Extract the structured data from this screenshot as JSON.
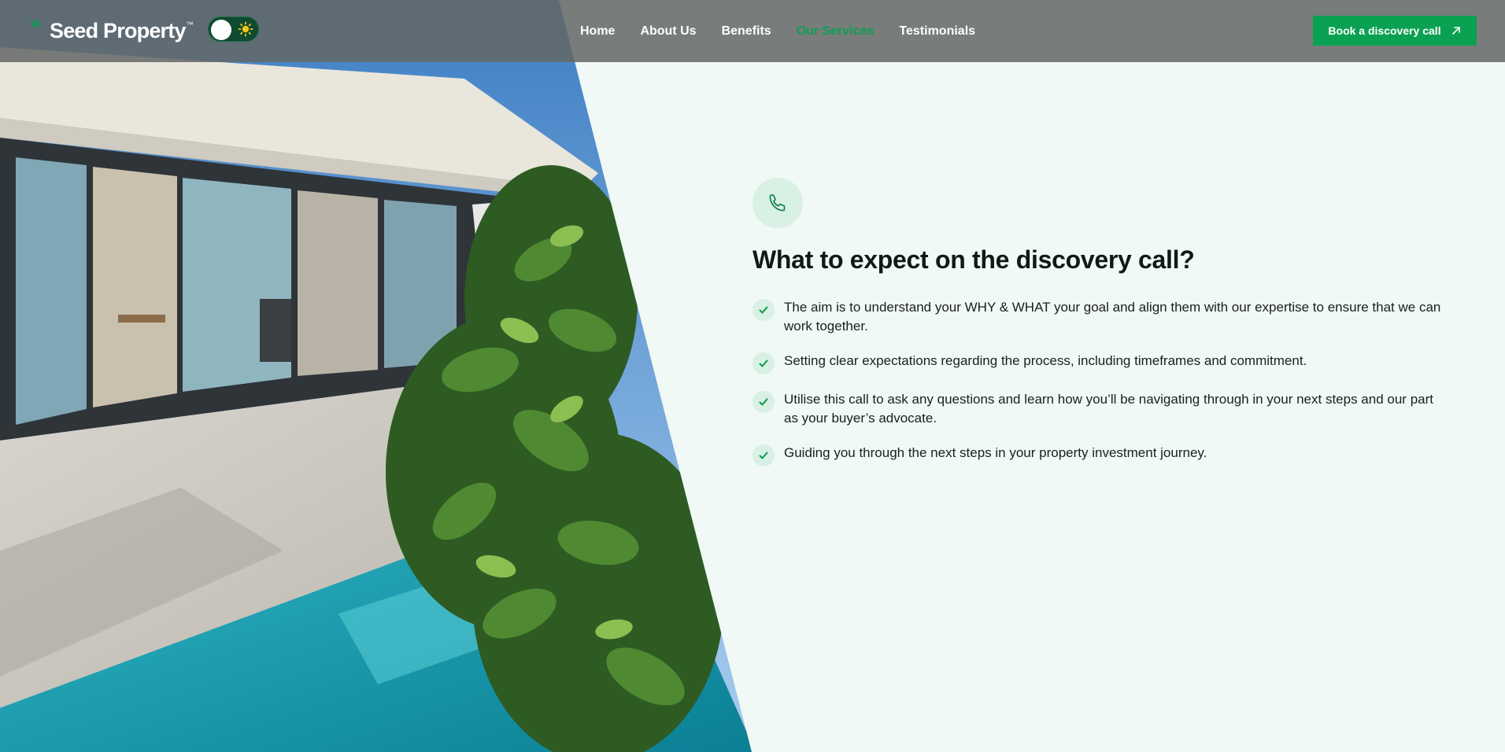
{
  "header": {
    "brand_name": "Seed Property",
    "brand_tm": "™",
    "nav": [
      {
        "label": "Home",
        "active": false
      },
      {
        "label": "About Us",
        "active": false
      },
      {
        "label": "Benefits",
        "active": false
      },
      {
        "label": "Our Services",
        "active": true
      },
      {
        "label": "Testimonials",
        "active": false
      }
    ],
    "cta_label": "Book a discovery call"
  },
  "icons": {
    "brand": "seedling-logo-icon",
    "toggle": "sun-icon",
    "cta": "arrow-up-right-icon",
    "section": "phone-icon",
    "list": "check-icon"
  },
  "colors": {
    "accent": "#0aa152",
    "active_nav": "#0e9f55",
    "page_background": "#f0f9f5",
    "badge_background": "#d9f0e4",
    "title": "#0f1a15"
  },
  "section": {
    "title": "What to expect on the discovery call?",
    "items": [
      "The aim is to understand your WHY & WHAT your goal and align them with our expertise to ensure that we can work together.",
      "Setting clear expectations regarding the process, including timeframes and commitment.",
      "Utilise this call to ask any questions and learn how you’ll be navigating through in your next steps and our part as your buyer’s advocate.",
      "Guiding you through the next steps in your property investment journey."
    ]
  }
}
